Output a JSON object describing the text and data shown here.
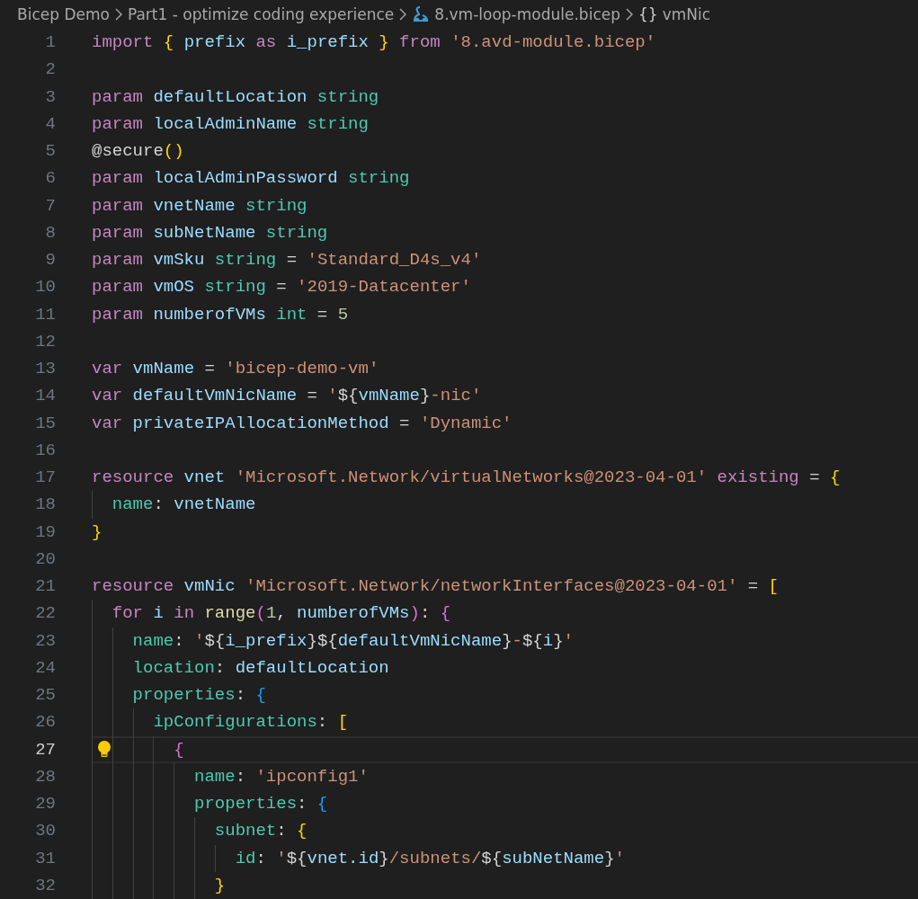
{
  "breadcrumb": [
    {
      "kind": "folder",
      "label": "Bicep Demo"
    },
    {
      "kind": "folder",
      "label": "Part1 - optimize coding experience"
    },
    {
      "kind": "file",
      "label": "8.vm-loop-module.bicep"
    },
    {
      "kind": "symbol",
      "icon_text": "{}",
      "label": "vmNic"
    }
  ],
  "editor": {
    "lines": [
      {
        "number": "1",
        "current": false,
        "tokens": [
          {
            "kind": "kw",
            "text": "import"
          },
          {
            "kind": "br1",
            "text": " {"
          },
          {
            "kind": "var",
            "text": " prefix"
          },
          {
            "kind": "kw",
            "text": " as"
          },
          {
            "kind": "var",
            "text": " i_prefix"
          },
          {
            "kind": "br1",
            "text": " }"
          },
          {
            "kind": "kw",
            "text": " from"
          },
          {
            "kind": "str",
            "text": " '8.avd-module.bicep'"
          }
        ]
      },
      {
        "number": "2",
        "current": false
      },
      {
        "number": "3",
        "current": false,
        "tokens": [
          {
            "kind": "kw",
            "text": "param"
          },
          {
            "kind": "var",
            "text": " defaultLocation"
          },
          {
            "kind": "type",
            "text": " string"
          }
        ]
      },
      {
        "number": "4",
        "current": false,
        "tokens": [
          {
            "kind": "kw",
            "text": "param"
          },
          {
            "kind": "var",
            "text": " localAdminName"
          },
          {
            "kind": "type",
            "text": " string"
          }
        ]
      },
      {
        "number": "5",
        "current": false,
        "tokens": [
          {
            "kind": "dec",
            "text": "@secure"
          },
          {
            "kind": "br1",
            "text": "()"
          }
        ]
      },
      {
        "number": "6",
        "current": false,
        "tokens": [
          {
            "kind": "kw",
            "text": "param"
          },
          {
            "kind": "var",
            "text": " localAdminPassword"
          },
          {
            "kind": "type",
            "text": " string"
          }
        ]
      },
      {
        "number": "7",
        "current": false,
        "tokens": [
          {
            "kind": "kw",
            "text": "param"
          },
          {
            "kind": "var",
            "text": " vnetName"
          },
          {
            "kind": "type",
            "text": " string"
          }
        ]
      },
      {
        "number": "8",
        "current": false,
        "tokens": [
          {
            "kind": "kw",
            "text": "param"
          },
          {
            "kind": "var",
            "text": " subNetName"
          },
          {
            "kind": "type",
            "text": " string"
          }
        ]
      },
      {
        "number": "9",
        "current": false,
        "tokens": [
          {
            "kind": "kw",
            "text": "param"
          },
          {
            "kind": "var",
            "text": " vmSku"
          },
          {
            "kind": "type",
            "text": " string"
          },
          {
            "kind": "punct",
            "text": " ="
          },
          {
            "kind": "str",
            "text": " 'Standard_D4s_v4'"
          }
        ]
      },
      {
        "number": "10",
        "current": false,
        "tokens": [
          {
            "kind": "kw",
            "text": "param"
          },
          {
            "kind": "var",
            "text": " vmOS"
          },
          {
            "kind": "type",
            "text": " string"
          },
          {
            "kind": "punct",
            "text": " ="
          },
          {
            "kind": "str",
            "text": " '2019-Datacenter'"
          }
        ]
      },
      {
        "number": "11",
        "current": false,
        "tokens": [
          {
            "kind": "kw",
            "text": "param"
          },
          {
            "kind": "var",
            "text": " numberofVMs"
          },
          {
            "kind": "type",
            "text": " int"
          },
          {
            "kind": "punct",
            "text": " ="
          },
          {
            "kind": "num",
            "text": " 5"
          }
        ]
      },
      {
        "number": "12",
        "current": false
      },
      {
        "number": "13",
        "current": false,
        "tokens": [
          {
            "kind": "kw",
            "text": "var"
          },
          {
            "kind": "var",
            "text": " vmName"
          },
          {
            "kind": "punct",
            "text": " ="
          },
          {
            "kind": "str",
            "text": " 'bicep-demo-vm'"
          }
        ]
      },
      {
        "number": "14",
        "current": false,
        "tokens": [
          {
            "kind": "kw",
            "text": "var"
          },
          {
            "kind": "var",
            "text": " defaultVmNicName"
          },
          {
            "kind": "punct",
            "text": " ="
          },
          {
            "kind": "str",
            "text": " '"
          },
          {
            "kind": "interp",
            "text": "${"
          },
          {
            "kind": "var",
            "text": "vmName"
          },
          {
            "kind": "interp",
            "text": "}"
          },
          {
            "kind": "str",
            "text": "-nic'"
          }
        ]
      },
      {
        "number": "15",
        "current": false,
        "tokens": [
          {
            "kind": "kw",
            "text": "var"
          },
          {
            "kind": "var",
            "text": " privateIPAllocationMethod"
          },
          {
            "kind": "punct",
            "text": " ="
          },
          {
            "kind": "str",
            "text": " 'Dynamic'"
          }
        ]
      },
      {
        "number": "16",
        "current": false
      },
      {
        "number": "17",
        "current": false,
        "tokens": [
          {
            "kind": "kw",
            "text": "resource"
          },
          {
            "kind": "var",
            "text": " vnet"
          },
          {
            "kind": "str",
            "text": " 'Microsoft.Network/virtualNetworks@2023-04-01'"
          },
          {
            "kind": "kw",
            "text": " existing"
          },
          {
            "kind": "punct",
            "text": " ="
          },
          {
            "kind": "br1",
            "text": " {"
          }
        ]
      },
      {
        "number": "18",
        "current": false,
        "tokens": [
          {
            "kind": "prop",
            "text": "  name"
          },
          {
            "kind": "punct",
            "text": ":"
          },
          {
            "kind": "var",
            "text": " vnetName"
          }
        ]
      },
      {
        "number": "19",
        "current": false,
        "tokens": [
          {
            "kind": "br1",
            "text": "}"
          }
        ]
      },
      {
        "number": "20",
        "current": false
      },
      {
        "number": "21",
        "current": false,
        "tokens": [
          {
            "kind": "kw",
            "text": "resource"
          },
          {
            "kind": "var",
            "text": " vmNic"
          },
          {
            "kind": "str",
            "text": " 'Microsoft.Network/networkInterfaces@2023-04-01'"
          },
          {
            "kind": "punct",
            "text": " ="
          },
          {
            "kind": "br1",
            "text": " ["
          }
        ]
      },
      {
        "number": "22",
        "current": false,
        "tokens": [
          {
            "kind": "kw",
            "text": "  for"
          },
          {
            "kind": "var",
            "text": " i"
          },
          {
            "kind": "kw",
            "text": " in"
          },
          {
            "kind": "fn",
            "text": " range"
          },
          {
            "kind": "br2",
            "text": "("
          },
          {
            "kind": "num",
            "text": "1"
          },
          {
            "kind": "punct",
            "text": ","
          },
          {
            "kind": "var",
            "text": " numberofVMs"
          },
          {
            "kind": "br2",
            "text": ")"
          },
          {
            "kind": "punct",
            "text": ":"
          },
          {
            "kind": "br2",
            "text": " {"
          }
        ]
      },
      {
        "number": "23",
        "current": false,
        "tokens": [
          {
            "kind": "prop",
            "text": "    name"
          },
          {
            "kind": "punct",
            "text": ":"
          },
          {
            "kind": "str",
            "text": " '"
          },
          {
            "kind": "interp",
            "text": "${"
          },
          {
            "kind": "var",
            "text": "i_prefix"
          },
          {
            "kind": "interp",
            "text": "}"
          },
          {
            "kind": "interp",
            "text": "${"
          },
          {
            "kind": "var",
            "text": "defaultVmNicName"
          },
          {
            "kind": "interp",
            "text": "}"
          },
          {
            "kind": "str",
            "text": "-"
          },
          {
            "kind": "interp",
            "text": "${"
          },
          {
            "kind": "var",
            "text": "i"
          },
          {
            "kind": "interp",
            "text": "}"
          },
          {
            "kind": "str",
            "text": "'"
          }
        ]
      },
      {
        "number": "24",
        "current": false,
        "tokens": [
          {
            "kind": "prop",
            "text": "    location"
          },
          {
            "kind": "punct",
            "text": ":"
          },
          {
            "kind": "var",
            "text": " defaultLocation"
          }
        ]
      },
      {
        "number": "25",
        "current": false,
        "tokens": [
          {
            "kind": "prop",
            "text": "    properties"
          },
          {
            "kind": "punct",
            "text": ":"
          },
          {
            "kind": "br3",
            "text": " {"
          }
        ]
      },
      {
        "number": "26",
        "current": false,
        "tokens": [
          {
            "kind": "prop",
            "text": "      ipConfigurations"
          },
          {
            "kind": "punct",
            "text": ":"
          },
          {
            "kind": "br1",
            "text": " ["
          }
        ]
      },
      {
        "number": "27",
        "current": true,
        "tokens": [
          {
            "kind": "br2",
            "text": "        {"
          }
        ]
      },
      {
        "number": "28",
        "current": false,
        "tokens": [
          {
            "kind": "prop",
            "text": "          name"
          },
          {
            "kind": "punct",
            "text": ":"
          },
          {
            "kind": "str",
            "text": " 'ipconfig1'"
          }
        ]
      },
      {
        "number": "29",
        "current": false,
        "tokens": [
          {
            "kind": "prop",
            "text": "          properties"
          },
          {
            "kind": "punct",
            "text": ":"
          },
          {
            "kind": "br3",
            "text": " {"
          }
        ]
      },
      {
        "number": "30",
        "current": false,
        "tokens": [
          {
            "kind": "prop",
            "text": "            subnet"
          },
          {
            "kind": "punct",
            "text": ":"
          },
          {
            "kind": "br1",
            "text": " {"
          }
        ]
      },
      {
        "number": "31",
        "current": false,
        "tokens": [
          {
            "kind": "prop",
            "text": "              id"
          },
          {
            "kind": "punct",
            "text": ":"
          },
          {
            "kind": "str",
            "text": " '"
          },
          {
            "kind": "interp",
            "text": "${"
          },
          {
            "kind": "var",
            "text": "vnet.id"
          },
          {
            "kind": "interp",
            "text": "}"
          },
          {
            "kind": "str",
            "text": "/subnets/"
          },
          {
            "kind": "interp",
            "text": "${"
          },
          {
            "kind": "var",
            "text": "subNetName"
          },
          {
            "kind": "interp",
            "text": "}"
          },
          {
            "kind": "str",
            "text": "'"
          }
        ]
      },
      {
        "number": "32",
        "current": false,
        "tokens": [
          {
            "kind": "br1",
            "text": "            }"
          }
        ]
      }
    ]
  }
}
